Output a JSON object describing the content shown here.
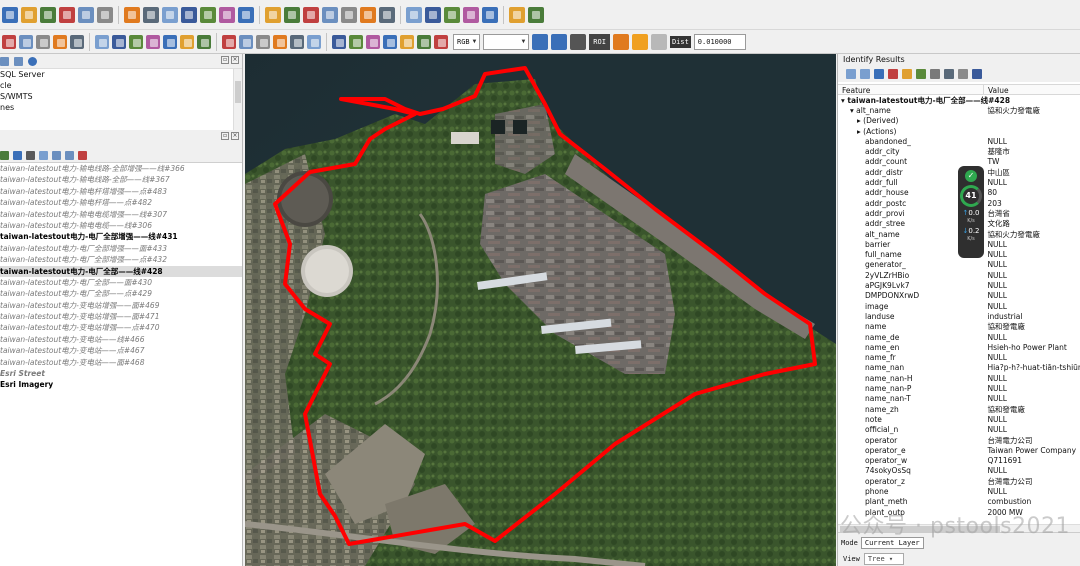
{
  "toolbar_top": {
    "icons": [
      "save-project-icon",
      "vertex-tool-icon",
      "digitize-icon",
      "select-icon",
      "zoom-icon",
      "layer-icon",
      "edit-pencil-icon",
      "stroke-icon",
      "node-icon",
      "cut-icon",
      "paste-icon",
      "undo-icon",
      "redo-icon",
      "label-icon",
      "label-pin-icon",
      "label-move-icon",
      "label-rotate-icon",
      "label-change-icon",
      "diagram-icon",
      "map-tips-icon",
      "hand-icon",
      "globe-icon",
      "python-icon",
      "georef-icon",
      "plugin-icon",
      "help-icon",
      "satellite-icon"
    ]
  },
  "toolbar_second": {
    "band_select": "RGB",
    "roi_label": "ROI",
    "dist_label": "Dist",
    "dist_value": "0.010000"
  },
  "browser_panel": {
    "items": [
      "SQL Server",
      "cle",
      "S/WMTS",
      "nes"
    ]
  },
  "layers_panel": {
    "layers": [
      {
        "name": "taiwan-latestout电力-输电线路-全部增强——线#366",
        "style": "muted"
      },
      {
        "name": "taiwan-latestout电力-输电线路-全部——线#367",
        "style": "muted"
      },
      {
        "name": "taiwan-latestout电力-输电杆塔增强——点#483",
        "style": "muted"
      },
      {
        "name": "taiwan-latestout电力-输电杆塔——点#482",
        "style": "muted"
      },
      {
        "name": "taiwan-latestout电力-输电电缆增强——线#307",
        "style": "muted"
      },
      {
        "name": "taiwan-latestout电力-输电电缆——线#306",
        "style": "muted"
      },
      {
        "name": "taiwan-latestout电力-电厂全部增强——线#431",
        "style": "bold"
      },
      {
        "name": "taiwan-latestout电力-电厂全部增强——面#433",
        "style": "muted"
      },
      {
        "name": "taiwan-latestout电力-电厂全部增强——点#432",
        "style": "muted"
      },
      {
        "name": "taiwan-latestout电力-电厂全部——线#428",
        "style": "bold-selected"
      },
      {
        "name": "taiwan-latestout电力-电厂全部——面#430",
        "style": "muted"
      },
      {
        "name": "taiwan-latestout电力-电厂全部——点#429",
        "style": "muted"
      },
      {
        "name": "taiwan-latestout电力-变电站增强——面#469",
        "style": "muted"
      },
      {
        "name": "taiwan-latestout电力-变电站增强——面#471",
        "style": "muted"
      },
      {
        "name": "taiwan-latestout电力-变电站增强——点#470",
        "style": "muted"
      },
      {
        "name": "taiwan-latestout电力-变电站——线#466",
        "style": "muted"
      },
      {
        "name": "taiwan-latestout电力-变电站——点#467",
        "style": "muted"
      },
      {
        "name": "taiwan-latestout电力-变电站——面#468",
        "style": "muted"
      },
      {
        "name": "Esri Street",
        "style": "bold-muted"
      },
      {
        "name": "Esri Imagery",
        "style": "bold"
      }
    ]
  },
  "identify": {
    "title": "Identify Results",
    "col_feature": "Feature",
    "col_value": "Value",
    "feature_name": "taiwan-latestout电力-电厂全部——线#428",
    "alt_name_group": "alt_name",
    "alt_name_value": "協和火力發電廠",
    "derived": "(Derived)",
    "actions": "(Actions)",
    "rows": [
      {
        "k": "abandoned_",
        "v": "NULL"
      },
      {
        "k": "addr_city",
        "v": "基隆市"
      },
      {
        "k": "addr_count",
        "v": "TW"
      },
      {
        "k": "addr_distr",
        "v": "中山區"
      },
      {
        "k": "addr_full",
        "v": "NULL"
      },
      {
        "k": "addr_house",
        "v": "80"
      },
      {
        "k": "addr_postc",
        "v": "203"
      },
      {
        "k": "addr_provi",
        "v": "台灣省"
      },
      {
        "k": "addr_stree",
        "v": "文化路"
      },
      {
        "k": "alt_name",
        "v": "協和火力發電廠"
      },
      {
        "k": "barrier",
        "v": "NULL"
      },
      {
        "k": "full_name",
        "v": "NULL"
      },
      {
        "k": "generator_",
        "v": "NULL"
      },
      {
        "k": "2yVLZrHBio",
        "v": "NULL"
      },
      {
        "k": "aPGJK9Lvk7",
        "v": "NULL"
      },
      {
        "k": "DMPDONXrwD",
        "v": "NULL"
      },
      {
        "k": "image",
        "v": "NULL"
      },
      {
        "k": "landuse",
        "v": "industrial"
      },
      {
        "k": "name",
        "v": "協和發電廠"
      },
      {
        "k": "name_de",
        "v": "NULL"
      },
      {
        "k": "name_en",
        "v": "Hsieh-ho Power Plant"
      },
      {
        "k": "name_fr",
        "v": "NULL"
      },
      {
        "k": "name_nan",
        "v": "Hia?p-h?-huat-tiān-tshiūnn"
      },
      {
        "k": "name_nan-H",
        "v": "NULL"
      },
      {
        "k": "name_nan-P",
        "v": "NULL"
      },
      {
        "k": "name_nan-T",
        "v": "NULL"
      },
      {
        "k": "name_zh",
        "v": "協和發電廠"
      },
      {
        "k": "note",
        "v": "NULL"
      },
      {
        "k": "official_n",
        "v": "NULL"
      },
      {
        "k": "operator",
        "v": "台灣電力公司"
      },
      {
        "k": "operator_e",
        "v": "Taiwan Power Company"
      },
      {
        "k": "operator_w",
        "v": "Q711691"
      },
      {
        "k": "74sokyOsSq",
        "v": "NULL"
      },
      {
        "k": "operator_z",
        "v": "台灣電力公司"
      },
      {
        "k": "phone",
        "v": "NULL"
      },
      {
        "k": "plant_meth",
        "v": "combustion"
      },
      {
        "k": "plant_outp",
        "v": "2000 MW"
      }
    ],
    "mode_label": "Mode",
    "mode_value": "Current Layer",
    "view_label": "View",
    "view_value": "Tree"
  },
  "net_widget": {
    "percent": "41",
    "percent_unit": "%",
    "up": "0.0",
    "down": "0.2",
    "unit": "K/s"
  },
  "watermark": "公众号 · pstools2021",
  "colors": {
    "boundary": "#ff0000",
    "sea": "#24343a",
    "vegetation": "#3d5a2e",
    "selected_row": "#dcdcdc"
  }
}
